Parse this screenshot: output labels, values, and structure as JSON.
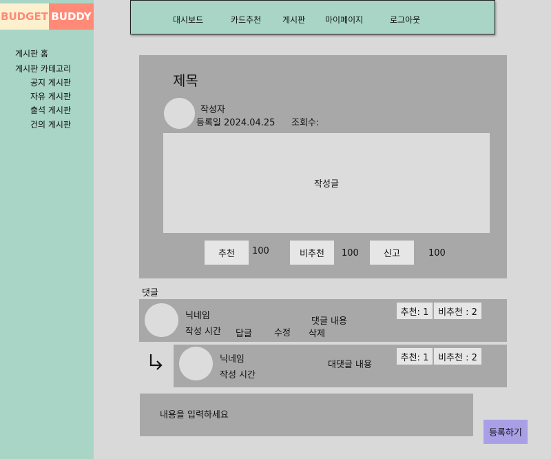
{
  "logo": {
    "left": "BUDGET",
    "right": "BUDDY"
  },
  "sidebar": {
    "items": [
      "게시판 홈",
      "게시판 카테고리"
    ],
    "sub_items": [
      "공지 게시판",
      "자유 게시판",
      "출석 게시판",
      "건의 게시판"
    ]
  },
  "nav": {
    "items": [
      "대시보드",
      "카드추천",
      "게시판",
      "마이페이지",
      "로그아웃"
    ]
  },
  "post": {
    "title": "제목",
    "author": "작성자",
    "date": "등록일 2024.04.25",
    "views": "조회수:",
    "content": "작성글",
    "like_label": "추천",
    "like_count": "100",
    "dislike_label": "비추천",
    "dislike_count": "100",
    "report_label": "신고",
    "report_count": "100"
  },
  "comments": {
    "label": "댓글",
    "items": [
      {
        "nickname": "닉네임",
        "time": "작성 시간",
        "content": "댓글 내용",
        "reply": "답글",
        "edit": "수정",
        "delete": "삭제",
        "like": "추천: 1",
        "dislike": "비추천 : 2"
      }
    ],
    "replies": [
      {
        "nickname": "닉네임",
        "time": "작성 시간",
        "content": "대댓글 내용",
        "like": "추천: 1",
        "dislike": "비추천 : 2"
      }
    ]
  },
  "input": {
    "placeholder": "내용을 입력하세요"
  },
  "submit_label": "등록하기",
  "colors": {
    "mint": "#a8d5c5",
    "cream": "#fdf0cf",
    "salmon": "#ff8a78",
    "panel_gray": "#a8a8a8",
    "light_gray": "#dcdcdc",
    "lavender": "#a89fe6"
  },
  "icons": {
    "reply_arrow": "reply-arrow-icon"
  }
}
